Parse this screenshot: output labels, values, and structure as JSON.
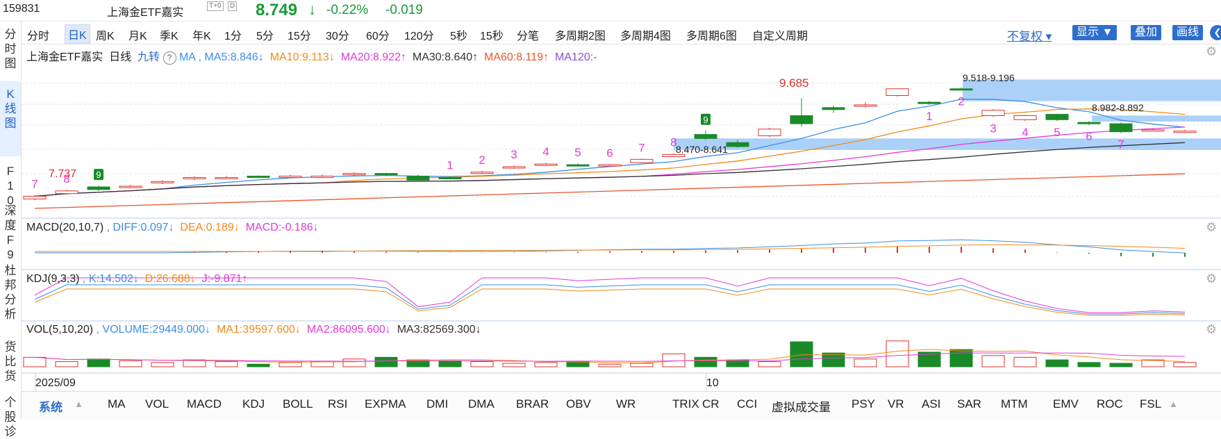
{
  "header": {
    "code": "159831",
    "name": "上海金ETF嘉实",
    "badge": "T+0",
    "badge2": "D",
    "price": "8.749",
    "price_arrow": "↓",
    "change_pct": "-0.22%",
    "change": "-0.019"
  },
  "sidebar": [
    {
      "label": "分时图"
    },
    {
      "label": "K线图"
    },
    {
      "label": "F10"
    },
    {
      "label": "深度F9"
    },
    {
      "label": "杜邦分析"
    },
    {
      "label": "货比货"
    },
    {
      "label": "个股诊"
    }
  ],
  "periods": [
    "分时",
    "日K",
    "周K",
    "月K",
    "季K",
    "年K",
    "1分",
    "5分",
    "15分",
    "30分",
    "60分",
    "120分",
    "5秒",
    "15秒",
    "分笔",
    "多周期2图",
    "多周期4图",
    "多周期6图",
    "自定义周期"
  ],
  "active_period": "日K",
  "controls": {
    "fuquan": "不复权",
    "display": "显示",
    "overlay": "叠加",
    "draw": "画线"
  },
  "main_panel": {
    "stock": "上海金ETF嘉实",
    "period": "日线",
    "jiuzhuan": "九转",
    "help": "?",
    "ma": "MA ,",
    "ma5": "MA5:8.846↓",
    "ma10": "MA10:9.113↓",
    "ma20": "MA20:8.922↑",
    "ma30": "MA30:8.640↑",
    "ma60": "MA60:8.119↑",
    "ma120": "MA120:-",
    "colors": {
      "ma5": "#3a8ee6",
      "ma10": "#f28a16",
      "ma20": "#e03ad8",
      "ma30": "#333333",
      "ma60": "#e8542a",
      "ma120": "#8a4fd0"
    },
    "annotations": {
      "low_label": "7.737",
      "high_label": "9.685",
      "zone1": "9.518-9.196",
      "zone2": "8.982-8.892",
      "zone3": "8.470-8.641"
    }
  },
  "macd_panel": {
    "title": "MACD(20,10,7)",
    "diff": ", DIFF:0.097↓",
    "dea": "DEA:0.189↓",
    "macd": "MACD:-0.186↓"
  },
  "kdj_panel": {
    "title": "KDJ(9,3,3)",
    "k": ", K:14.502↓",
    "d": "D:26.688↓",
    "j": "J:-9.871↑"
  },
  "vol_panel": {
    "title": "VOL(5,10,20)",
    "volume": ", VOLUME:29449.000↓",
    "ma1": "MA1:39597.600↓",
    "ma2": "MA2:86095.600↓",
    "ma3": "MA3:82569.300↓"
  },
  "x_axis": {
    "label1": "2025/09",
    "label2": "10"
  },
  "bottom_tabs": [
    "系统",
    "MA",
    "VOL",
    "MACD",
    "KDJ",
    "BOLL",
    "RSI",
    "EXPMA",
    "DMI",
    "DMA",
    "BRAR",
    "OBV",
    "WR",
    "TRIX",
    "CR",
    "CCI",
    "虚拟成交量",
    "PSY",
    "VR",
    "ASI",
    "SAR",
    "MTM",
    "EMV",
    "ROC",
    "FSL"
  ],
  "nine_labels": {
    "up_seq": [
      "7",
      "8",
      "9",
      "1",
      "2",
      "3",
      "4",
      "5",
      "6",
      "7",
      "8",
      "9"
    ],
    "down_seq": [
      "1",
      "2",
      "3",
      "4",
      "5",
      "6",
      "7"
    ]
  },
  "chart_data": {
    "type": "candlestick",
    "candles": [
      {
        "o": 7.74,
        "c": 7.78,
        "h": 7.8,
        "l": 7.72
      },
      {
        "o": 7.82,
        "c": 7.86,
        "h": 7.88,
        "l": 7.8
      },
      {
        "o": 7.92,
        "c": 7.88,
        "h": 7.94,
        "l": 7.86
      },
      {
        "o": 7.92,
        "c": 7.93,
        "h": 7.95,
        "l": 7.9
      },
      {
        "o": 7.98,
        "c": 8.0,
        "h": 8.02,
        "l": 7.96
      },
      {
        "o": 8.04,
        "c": 8.06,
        "h": 8.08,
        "l": 8.02
      },
      {
        "o": 8.05,
        "c": 8.06,
        "h": 8.08,
        "l": 8.03
      },
      {
        "o": 8.08,
        "c": 8.07,
        "h": 8.09,
        "l": 8.05
      },
      {
        "o": 8.07,
        "c": 8.08,
        "h": 8.1,
        "l": 8.05
      },
      {
        "o": 8.07,
        "c": 8.08,
        "h": 8.1,
        "l": 8.05
      },
      {
        "o": 8.1,
        "c": 8.12,
        "h": 8.14,
        "l": 8.08
      },
      {
        "o": 8.12,
        "c": 8.1,
        "h": 8.13,
        "l": 8.08
      },
      {
        "o": 8.08,
        "c": 8.02,
        "h": 8.1,
        "l": 8.0
      },
      {
        "o": 8.06,
        "c": 8.05,
        "h": 8.08,
        "l": 8.03
      },
      {
        "o": 8.12,
        "c": 8.14,
        "h": 8.16,
        "l": 8.11
      },
      {
        "o": 8.2,
        "c": 8.22,
        "h": 8.24,
        "l": 8.19
      },
      {
        "o": 8.24,
        "c": 8.26,
        "h": 8.28,
        "l": 8.23
      },
      {
        "o": 8.25,
        "c": 8.24,
        "h": 8.27,
        "l": 8.22
      },
      {
        "o": 8.24,
        "c": 8.25,
        "h": 8.26,
        "l": 8.22
      },
      {
        "o": 8.28,
        "c": 8.33,
        "h": 8.34,
        "l": 8.27
      },
      {
        "o": 8.37,
        "c": 8.4,
        "h": 8.42,
        "l": 8.36
      },
      {
        "o": 8.7,
        "c": 8.64,
        "h": 8.76,
        "l": 8.62
      },
      {
        "o": 8.58,
        "c": 8.52,
        "h": 8.62,
        "l": 8.5
      },
      {
        "o": 8.68,
        "c": 8.78,
        "h": 8.8,
        "l": 8.66
      },
      {
        "o": 8.98,
        "c": 8.86,
        "h": 9.24,
        "l": 8.82
      },
      {
        "o": 9.1,
        "c": 9.07,
        "h": 9.13,
        "l": 9.02
      },
      {
        "o": 9.12,
        "c": 9.14,
        "h": 9.18,
        "l": 9.1
      },
      {
        "o": 9.28,
        "c": 9.38,
        "h": 9.38,
        "l": 9.26
      },
      {
        "o": 9.18,
        "c": 9.16,
        "h": 9.2,
        "l": 9.14
      },
      {
        "o": 9.38,
        "c": 9.37,
        "h": 9.4,
        "l": 9.36
      },
      {
        "o": 8.98,
        "c": 9.06,
        "h": 9.08,
        "l": 8.96
      },
      {
        "o": 8.92,
        "c": 8.98,
        "h": 8.99,
        "l": 8.9
      },
      {
        "o": 9.0,
        "c": 8.92,
        "h": 9.01,
        "l": 8.9
      },
      {
        "o": 8.88,
        "c": 8.86,
        "h": 8.9,
        "l": 8.84
      },
      {
        "o": 8.86,
        "c": 8.74,
        "h": 8.88,
        "l": 8.72
      },
      {
        "o": 8.76,
        "c": 8.77,
        "h": 8.79,
        "l": 8.75
      },
      {
        "o": 8.75,
        "c": 8.75,
        "h": 8.77,
        "l": 8.72
      }
    ],
    "volume": [
      22,
      12,
      18,
      14,
      10,
      16,
      12,
      6,
      10,
      12,
      18,
      22,
      16,
      14,
      12,
      8,
      10,
      12,
      6,
      8,
      30,
      22,
      16,
      12,
      58,
      32,
      18,
      60,
      34,
      40,
      26,
      22,
      16,
      10,
      8,
      16,
      10
    ],
    "ylim": [
      7.6,
      9.75
    ]
  }
}
